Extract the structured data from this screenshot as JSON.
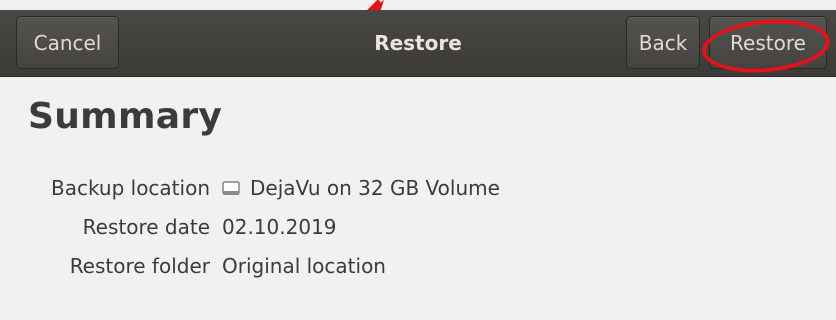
{
  "header": {
    "cancel_label": "Cancel",
    "title": "Restore",
    "back_label": "Back",
    "restore_label": "Restore"
  },
  "summary": {
    "title": "Summary",
    "rows": [
      {
        "label": "Backup location",
        "value": "DejaVu on 32 GB Volume",
        "icon": "drive-icon"
      },
      {
        "label": "Restore date",
        "value": "02.10.2019"
      },
      {
        "label": "Restore folder",
        "value": "Original location"
      }
    ]
  },
  "colors": {
    "headerbar": "#3d3c38",
    "annotation": "#e4121b",
    "background": "#f2f1f0",
    "text": "#3b3b3b"
  }
}
